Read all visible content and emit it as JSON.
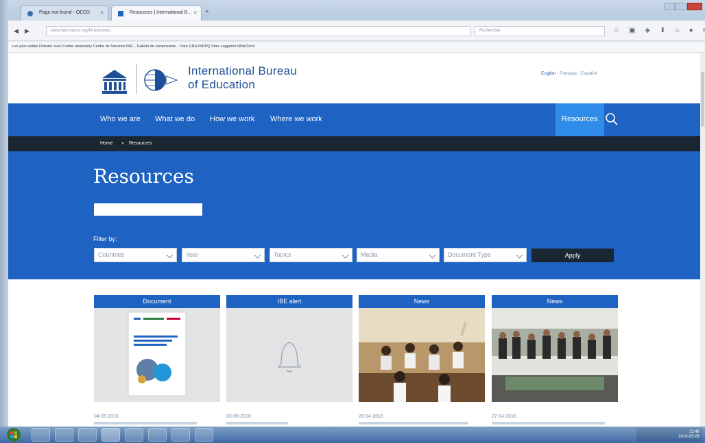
{
  "browser": {
    "tab1_title": "Page not found - OECD",
    "tab2_title": "Resources | International B...",
    "url": "www.ibe.unesco.org/fr/resources",
    "search_placeholder": "Rechercher",
    "bookmarks": "Les plus visités  Débuter avec Firefox  absolutely  Centre de Services IND...  Galerie de composants...  Pare GRH INDPQ  Sites suggérés  WebClient"
  },
  "header": {
    "title_line1": "International Bureau",
    "title_line2": "of Education",
    "lang_english": "English",
    "lang_others": " · Français · Español"
  },
  "nav": {
    "items": [
      "Who we are",
      "What we do",
      "How we work",
      "Where we work"
    ],
    "resources": "Resources"
  },
  "breadcrumb": {
    "home": "Home",
    "sep": "»",
    "current": "Resources"
  },
  "hero": {
    "title": "Resources",
    "filter_label": "Filter by:",
    "filters": [
      "Countries",
      "Year",
      "Topics",
      "Media",
      "Document Type"
    ],
    "apply": "Apply"
  },
  "cards": [
    {
      "label": "Document",
      "date": "04-05-2016"
    },
    {
      "label": "IBE alert",
      "date": "03-05-2016"
    },
    {
      "label": "News",
      "date": "28-04-2016"
    },
    {
      "label": "News",
      "date": "27-04-2016"
    }
  ],
  "taskbar": {
    "time": "13:48",
    "date": "2016-05-06"
  },
  "colors": {
    "brand_blue": "#1e63c2",
    "dark": "#1b2633",
    "highlight": "#2f8ce8"
  }
}
